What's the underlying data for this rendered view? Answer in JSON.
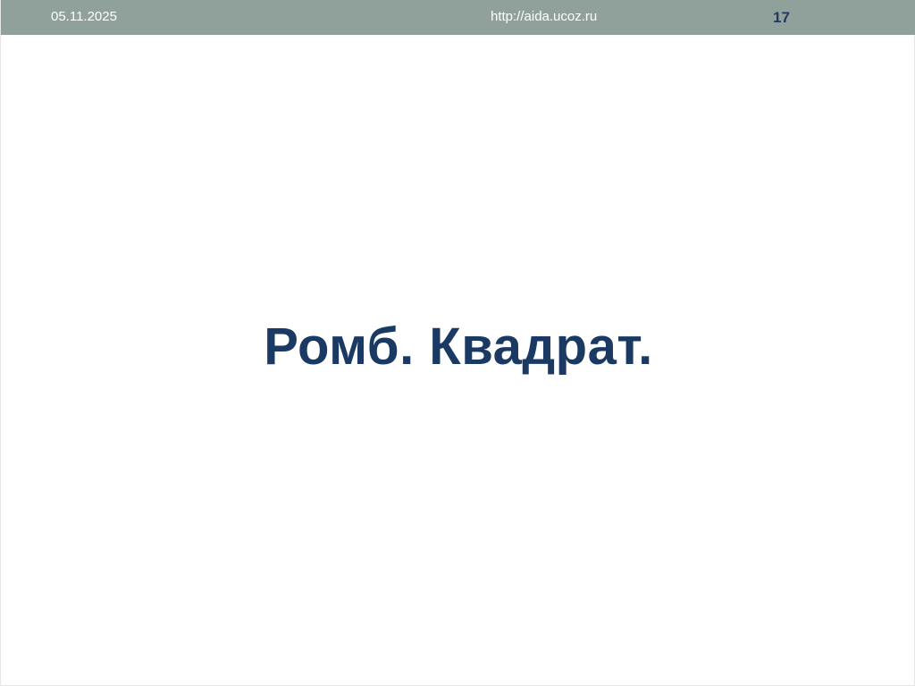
{
  "header": {
    "date": "05.11.2025",
    "url": "http://aida.ucoz.ru",
    "page_number": "17"
  },
  "slide": {
    "title": "Ромб. Квадрат."
  },
  "colors": {
    "header_background": "#8fa19a",
    "header_text": "#ffffff",
    "page_number": "#1f3a5c",
    "title_text": "#1b3a63"
  }
}
